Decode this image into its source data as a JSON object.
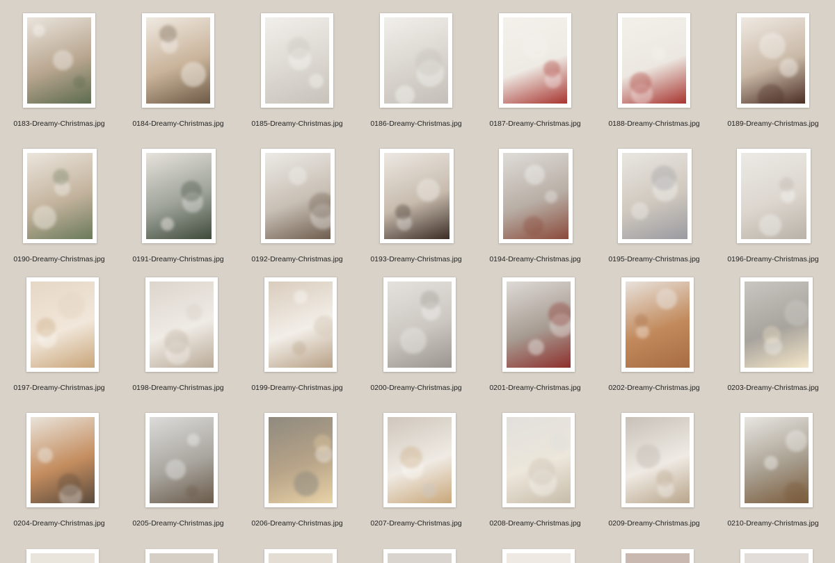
{
  "files": [
    {
      "name": "0183-Dreamy-Christmas.jpg",
      "tone": [
        "#e9e4dc",
        "#b9a690",
        "#5c6b4e"
      ]
    },
    {
      "name": "0184-Dreamy-Christmas.jpg",
      "tone": [
        "#efe9e1",
        "#c9b39a",
        "#6d5a45"
      ]
    },
    {
      "name": "0185-Dreamy-Christmas.jpg",
      "tone": [
        "#f1efeb",
        "#dcd8d1",
        "#c7c2ba"
      ]
    },
    {
      "name": "0186-Dreamy-Christmas.jpg",
      "tone": [
        "#f1efeb",
        "#d9d5ce",
        "#c4bfb8"
      ]
    },
    {
      "name": "0187-Dreamy-Christmas.jpg",
      "tone": [
        "#f4f1ec",
        "#eeeae4",
        "#a8342f"
      ]
    },
    {
      "name": "0188-Dreamy-Christmas.jpg",
      "tone": [
        "#f3f0ea",
        "#ece8e1",
        "#a8342f"
      ]
    },
    {
      "name": "0189-Dreamy-Christmas.jpg",
      "tone": [
        "#efe9e2",
        "#c9b8a6",
        "#4a2e24"
      ]
    },
    {
      "name": "0190-Dreamy-Christmas.jpg",
      "tone": [
        "#ebe5dc",
        "#c3b39d",
        "#6b7a5a"
      ]
    },
    {
      "name": "0191-Dreamy-Christmas.jpg",
      "tone": [
        "#e6e2dc",
        "#9ea39a",
        "#3f4a3a"
      ]
    },
    {
      "name": "0192-Dreamy-Christmas.jpg",
      "tone": [
        "#eceae6",
        "#c8bfb4",
        "#6e5d4e"
      ]
    },
    {
      "name": "0193-Dreamy-Christmas.jpg",
      "tone": [
        "#ece8e2",
        "#c7bbad",
        "#3a2c24"
      ]
    },
    {
      "name": "0194-Dreamy-Christmas.jpg",
      "tone": [
        "#dfdcd8",
        "#b8aea5",
        "#8a4a3a"
      ]
    },
    {
      "name": "0195-Dreamy-Christmas.jpg",
      "tone": [
        "#e9e6e1",
        "#cfc8be",
        "#9a9aa0"
      ]
    },
    {
      "name": "0196-Dreamy-Christmas.jpg",
      "tone": [
        "#eceae6",
        "#dcd6ce",
        "#b9b2a8"
      ]
    },
    {
      "name": "0197-Dreamy-Christmas.jpg",
      "tone": [
        "#e6d7c6",
        "#f1e7da",
        "#c9a57a"
      ]
    },
    {
      "name": "0198-Dreamy-Christmas.jpg",
      "tone": [
        "#dcd5cc",
        "#efebe5",
        "#b9aa97"
      ]
    },
    {
      "name": "0199-Dreamy-Christmas.jpg",
      "tone": [
        "#d9ccbc",
        "#f2eee8",
        "#b8a186"
      ]
    },
    {
      "name": "0200-Dreamy-Christmas.jpg",
      "tone": [
        "#e4e1dd",
        "#ccc7c1",
        "#9a958e"
      ]
    },
    {
      "name": "0201-Dreamy-Christmas.jpg",
      "tone": [
        "#dedad6",
        "#a79c92",
        "#8e2f2c"
      ]
    },
    {
      "name": "0202-Dreamy-Christmas.jpg",
      "tone": [
        "#e8e2dc",
        "#c28a5c",
        "#a76b43"
      ]
    },
    {
      "name": "0203-Dreamy-Christmas.jpg",
      "tone": [
        "#c9c6c1",
        "#a7a39d",
        "#f4e6c8"
      ]
    },
    {
      "name": "0204-Dreamy-Christmas.jpg",
      "tone": [
        "#e9e3da",
        "#c48d5f",
        "#5a4a3c"
      ]
    },
    {
      "name": "0205-Dreamy-Christmas.jpg",
      "tone": [
        "#dcdbd9",
        "#a9a69f",
        "#6a5a4a"
      ]
    },
    {
      "name": "0206-Dreamy-Christmas.jpg",
      "tone": [
        "#8f8a7f",
        "#b8a488",
        "#e8d2a8"
      ]
    },
    {
      "name": "0207-Dreamy-Christmas.jpg",
      "tone": [
        "#cfc7bd",
        "#efeae3",
        "#c9a77a"
      ]
    },
    {
      "name": "0208-Dreamy-Christmas.jpg",
      "tone": [
        "#e2e0dc",
        "#ece6db",
        "#c7bca9"
      ]
    },
    {
      "name": "0209-Dreamy-Christmas.jpg",
      "tone": [
        "#c7c1b8",
        "#efeae3",
        "#b8a58b"
      ]
    },
    {
      "name": "0210-Dreamy-Christmas.jpg",
      "tone": [
        "#e8e6e2",
        "#a89f90",
        "#7a5a3a"
      ]
    }
  ],
  "partial_row_tones": [
    "#e9e4dc",
    "#d6cfc5",
    "#e3ddd4",
    "#d9d4ce",
    "#efe9e3",
    "#c9b8b0",
    "#e2ddd8"
  ]
}
